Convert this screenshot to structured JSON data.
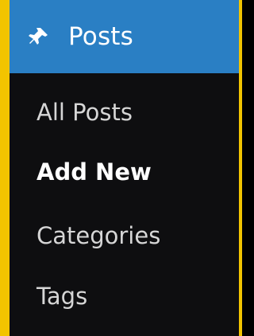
{
  "header": {
    "icon": "pushpin-icon",
    "title": "Posts",
    "colors": {
      "header_bg": "#2a7fc4",
      "panel_bg": "#0e0e10",
      "accent_border": "#f2c400"
    }
  },
  "menu": {
    "items": [
      {
        "label": "All Posts",
        "active": false
      },
      {
        "label": "Add New",
        "active": true
      },
      {
        "label": "Categories",
        "active": false
      },
      {
        "label": "Tags",
        "active": false
      }
    ]
  }
}
